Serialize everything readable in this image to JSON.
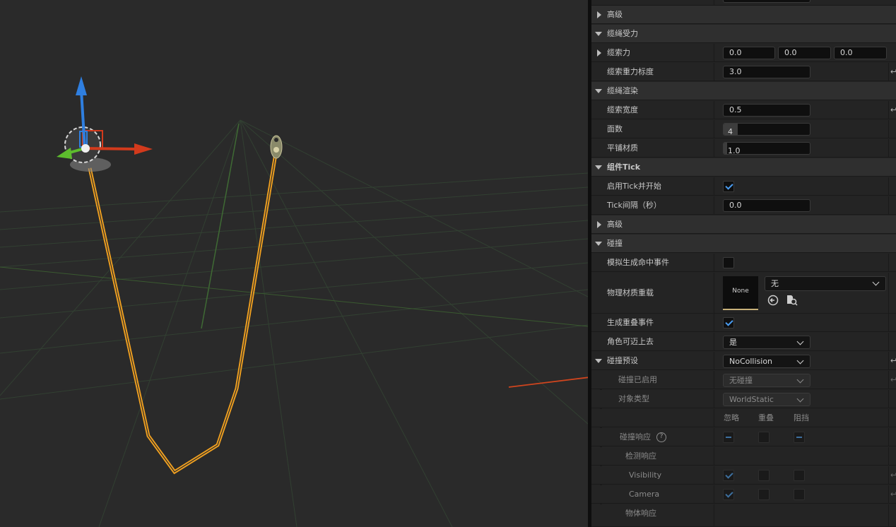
{
  "colors": {
    "cable": "#f0a020",
    "axis_x": "#d23a1c",
    "axis_y": "#5dbd2d",
    "axis_z": "#2f7fe0",
    "annotation_arrow": "#d0451e",
    "check": "#4a9cf0"
  },
  "panel": {
    "advanced_1": "高级",
    "cable_force_section": "缆绳受力",
    "cable_force": {
      "label": "缆索力",
      "x": "0.0",
      "y": "0.0",
      "z": "0.0"
    },
    "cable_gravity_scale": {
      "label": "缆索重力标度",
      "value": "3.0"
    },
    "cable_render_section": "缆绳渲染",
    "cable_width": {
      "label": "缆索宽度",
      "value": "0.5"
    },
    "num_sides": {
      "label": "面数",
      "value": "4"
    },
    "tile_material": {
      "label": "平铺材质",
      "value": "1.0"
    },
    "component_tick_section": "组件Tick",
    "start_with_tick": {
      "label": "启用Tick并开始",
      "checked": true
    },
    "tick_interval": {
      "label": "Tick间隔（秒）",
      "value": "0.0"
    },
    "advanced_2": "高级",
    "collision_section": "碰撞",
    "sim_hit_events": {
      "label": "模拟生成命中事件",
      "checked": false
    },
    "phys_material_override": {
      "label": "物理材质重载",
      "thumbnail": "None",
      "value": "无",
      "icons": [
        "use-selected-icon",
        "browse-icon"
      ]
    },
    "gen_overlap_events": {
      "label": "生成重叠事件",
      "checked": true
    },
    "can_step_up": {
      "label": "角色可迈上去",
      "value": "是"
    },
    "collision_presets": {
      "label": "碰撞预设",
      "value": "NoCollision"
    },
    "collision_enabled": {
      "label": "碰撞已启用",
      "value": "无碰撞"
    },
    "object_type": {
      "label": "对象类型",
      "value": "WorldStatic"
    },
    "response_headers": [
      "忽略",
      "重叠",
      "阻挡"
    ],
    "collision_responses": {
      "label": "碰撞响应",
      "help": "?"
    },
    "trace_responses": "检测响应",
    "visibility": {
      "label": "Visibility"
    },
    "camera": {
      "label": "Camera"
    },
    "object_responses": "物体响应"
  }
}
